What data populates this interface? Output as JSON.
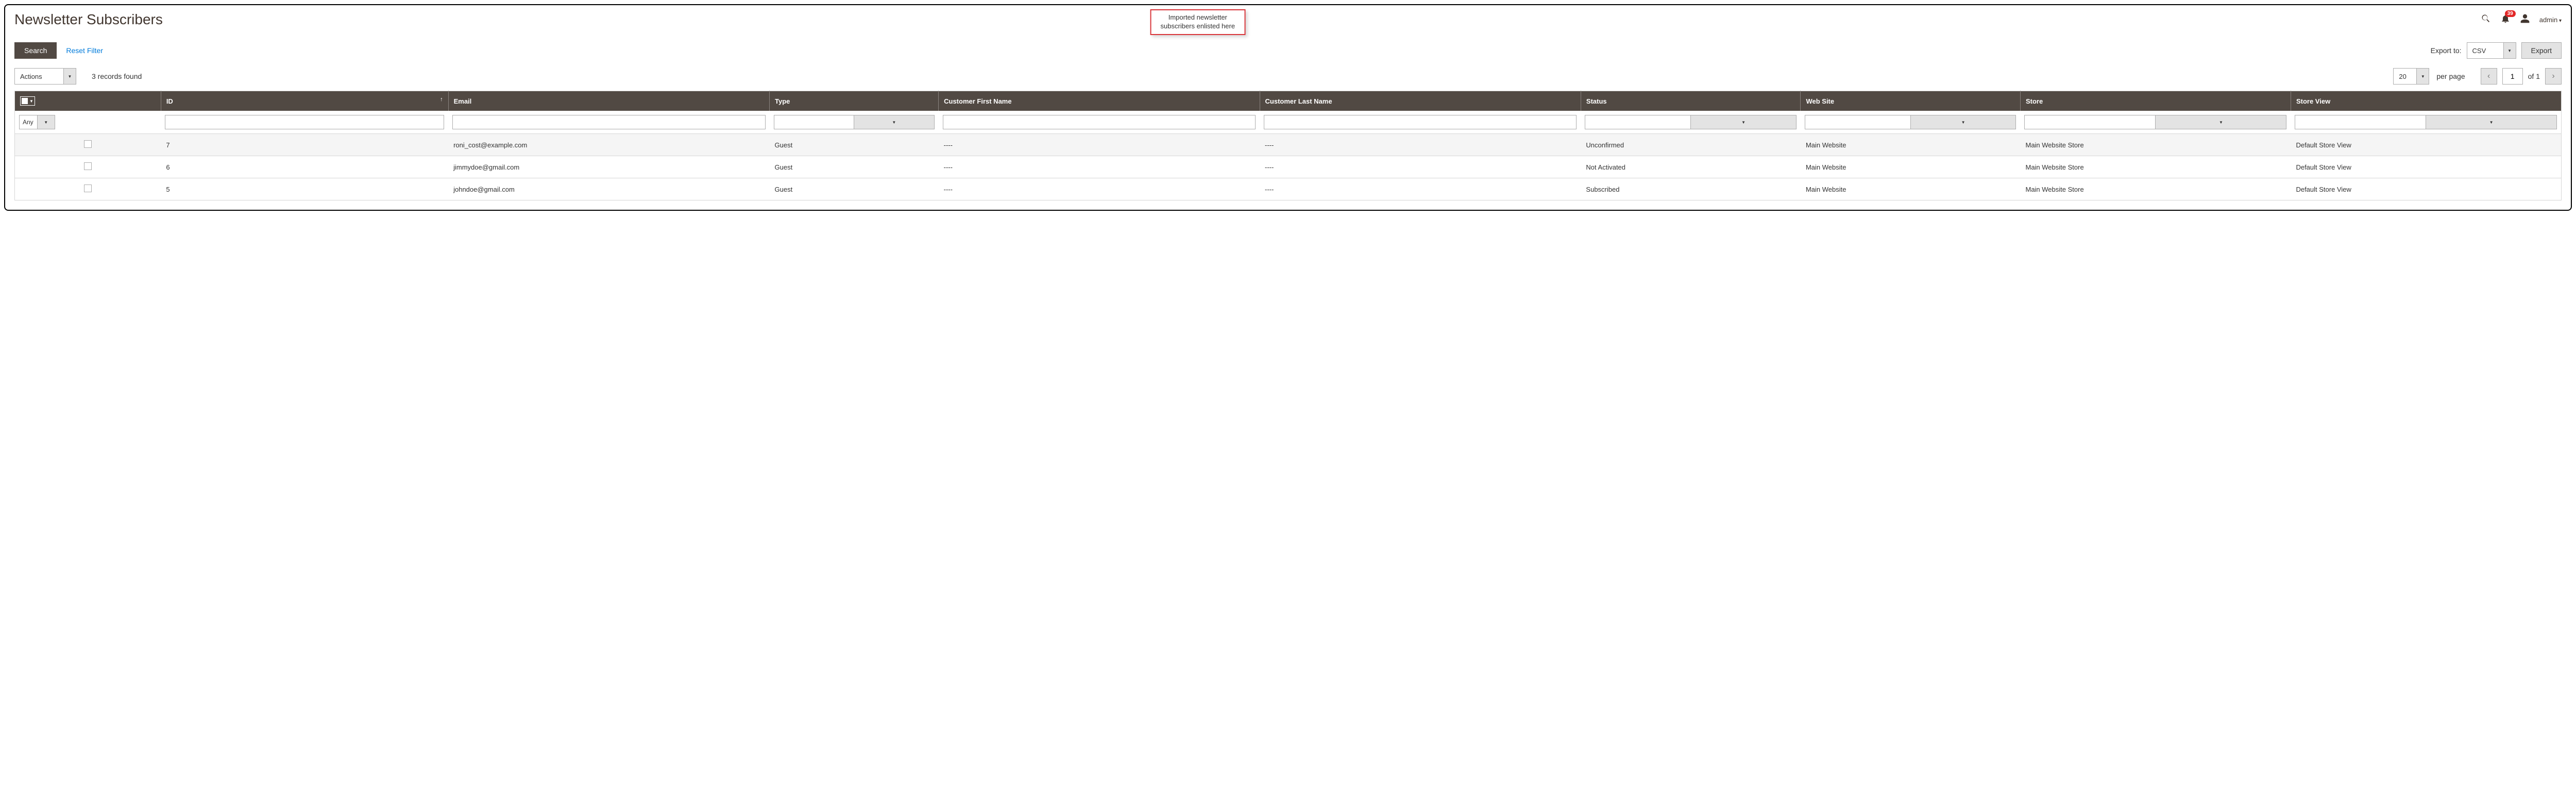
{
  "header": {
    "title": "Newsletter Subscribers",
    "callout_line1": "Imported newsletter",
    "callout_line2": "subscribers enlisted here",
    "notif_count": "39",
    "admin_label": "admin"
  },
  "toolbar": {
    "search_label": "Search",
    "reset_label": "Reset Filter",
    "export_to_label": "Export to:",
    "export_format": "CSV",
    "export_button": "Export"
  },
  "controls": {
    "actions_label": "Actions",
    "records_found": "3 records found",
    "per_page_value": "20",
    "per_page_label": "per page",
    "page_value": "1",
    "of_label": "of 1"
  },
  "columns": {
    "id": "ID",
    "email": "Email",
    "type": "Type",
    "first_name": "Customer First Name",
    "last_name": "Customer Last Name",
    "status": "Status",
    "website": "Web Site",
    "store": "Store",
    "store_view": "Store View"
  },
  "filter": {
    "any": "Any"
  },
  "rows": [
    {
      "id": "7",
      "email": "roni_cost@example.com",
      "type": "Guest",
      "first_name": "----",
      "last_name": "----",
      "status": "Unconfirmed",
      "website": "Main Website",
      "store": "Main Website Store",
      "store_view": "Default Store View"
    },
    {
      "id": "6",
      "email": "jimmydoe@gmail.com",
      "type": "Guest",
      "first_name": "----",
      "last_name": "----",
      "status": "Not Activated",
      "website": "Main Website",
      "store": "Main Website Store",
      "store_view": "Default Store View"
    },
    {
      "id": "5",
      "email": "johndoe@gmail.com",
      "type": "Guest",
      "first_name": "----",
      "last_name": "----",
      "status": "Subscribed",
      "website": "Main Website",
      "store": "Main Website Store",
      "store_view": "Default Store View"
    }
  ]
}
